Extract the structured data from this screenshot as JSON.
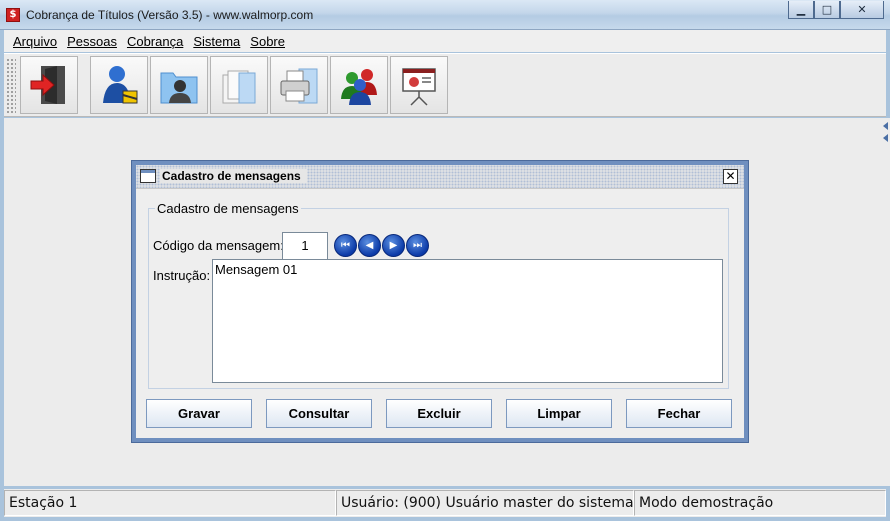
{
  "window": {
    "title": "Cobrança de Títulos (Versão 3.5) - www.walmorp.com",
    "app_icon_letter": "$",
    "controls": {
      "minimize": "▁",
      "maximize": "□",
      "close": "✕"
    }
  },
  "menu": {
    "items": [
      {
        "label": "Arquivo"
      },
      {
        "label": "Pessoas"
      },
      {
        "label": "Cobrança"
      },
      {
        "label": "Sistema"
      },
      {
        "label": "Sobre"
      }
    ]
  },
  "toolbar": {
    "buttons": [
      {
        "icon": "exit-door-icon"
      },
      {
        "icon": "user-lock-icon"
      },
      {
        "icon": "person-folder-icon"
      },
      {
        "icon": "documents-folder-icon"
      },
      {
        "icon": "printer-folder-icon"
      },
      {
        "icon": "users-group-icon"
      },
      {
        "icon": "presentation-board-icon"
      }
    ]
  },
  "dialog": {
    "title": "Cadastro de mensagens",
    "group_legend": "Cadastro de mensagens",
    "code_label": "Código da mensagem:",
    "code_value": "1",
    "nav_buttons": [
      "first-record-icon",
      "previous-record-icon",
      "next-record-icon",
      "last-record-icon"
    ],
    "instruction_label": "Instrução:",
    "instruction_value": "Mensagem 01",
    "buttons": {
      "save": "Gravar",
      "query": "Consultar",
      "delete": "Excluir",
      "clear": "Limpar",
      "close": "Fechar"
    }
  },
  "status": {
    "station": "Estação 1",
    "user": "Usuário: (900) Usuário master do sistema",
    "mode": "Modo demostração"
  },
  "colors": {
    "titlebar": "#c3d6ea",
    "dialog_border": "#6f8fbf",
    "nav_blue": "#0b3aa8",
    "desktop": "#ececec"
  }
}
